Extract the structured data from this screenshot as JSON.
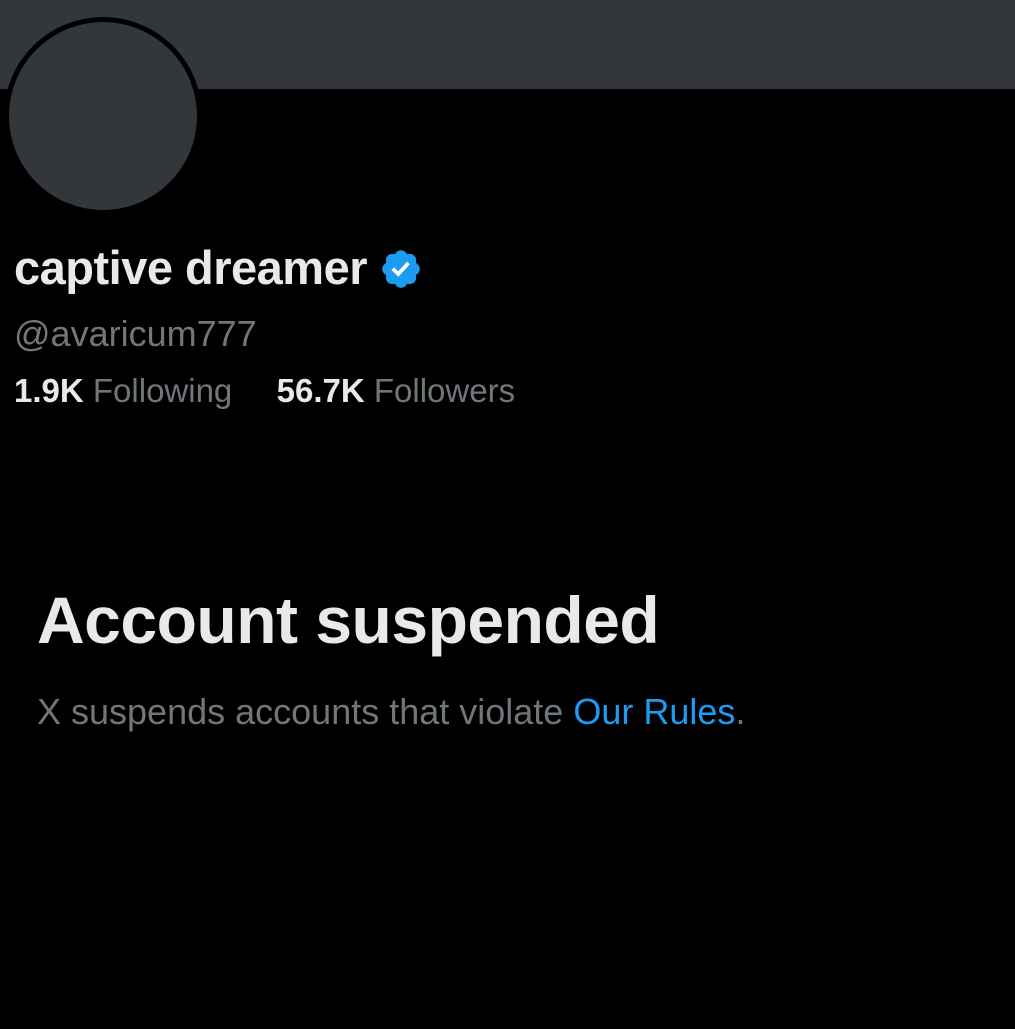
{
  "profile": {
    "display_name": "captive dreamer",
    "verified_icon": "verified-badge-icon",
    "handle": "@avaricum777",
    "following_count": "1.9K",
    "following_label": "Following",
    "followers_count": "56.7K",
    "followers_label": "Followers"
  },
  "suspension": {
    "title": "Account suspended",
    "description_prefix": "X suspends accounts that violate ",
    "rules_link": "Our Rules",
    "description_suffix": "."
  },
  "colors": {
    "background": "#000000",
    "banner": "#33363b",
    "primary_text": "#e7e9ea",
    "secondary_text": "#71767b",
    "link": "#1d9bf0",
    "verified": "#1d9bf0"
  }
}
